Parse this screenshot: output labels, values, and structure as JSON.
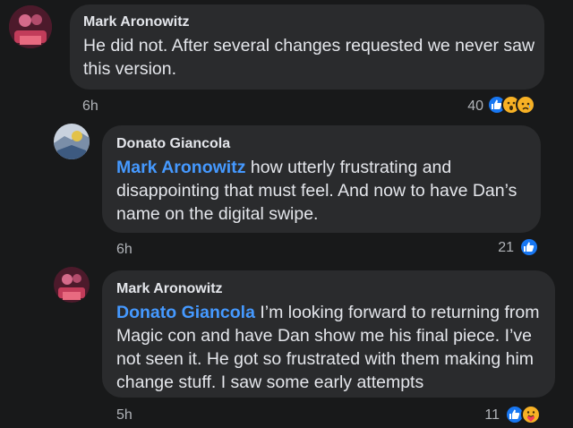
{
  "comments": [
    {
      "author": "Mark Aronowitz",
      "mention": "",
      "text": "He did not. After several changes requested we never saw this version.",
      "time": "6h",
      "reaction_count": "40",
      "reactions": [
        "like-icon",
        "wow-icon",
        "sad-icon"
      ]
    },
    {
      "author": "Donato Giancola",
      "mention": "Mark Aronowitz",
      "text": "how utterly frustrating and disappointing that must feel. And now to have Dan’s name on the digital swipe.",
      "time": "6h",
      "reaction_count": "21",
      "reactions": [
        "like-icon"
      ]
    },
    {
      "author": "Mark Aronowitz",
      "mention": "Donato Giancola",
      "text": "I’m looking forward to returning from Magic con and have Dan show me his final piece. I’ve not seen it. He got so frustrated with them making him change stuff. I saw some early attempts",
      "time": "5h",
      "reaction_count": "11",
      "reactions": [
        "like-icon",
        "care-icon"
      ]
    }
  ],
  "colors": {
    "background": "#18191a",
    "bubble": "#2a2b2d",
    "mention": "#4599ff",
    "like": "#1877f2",
    "emoji": "#f7b125"
  }
}
